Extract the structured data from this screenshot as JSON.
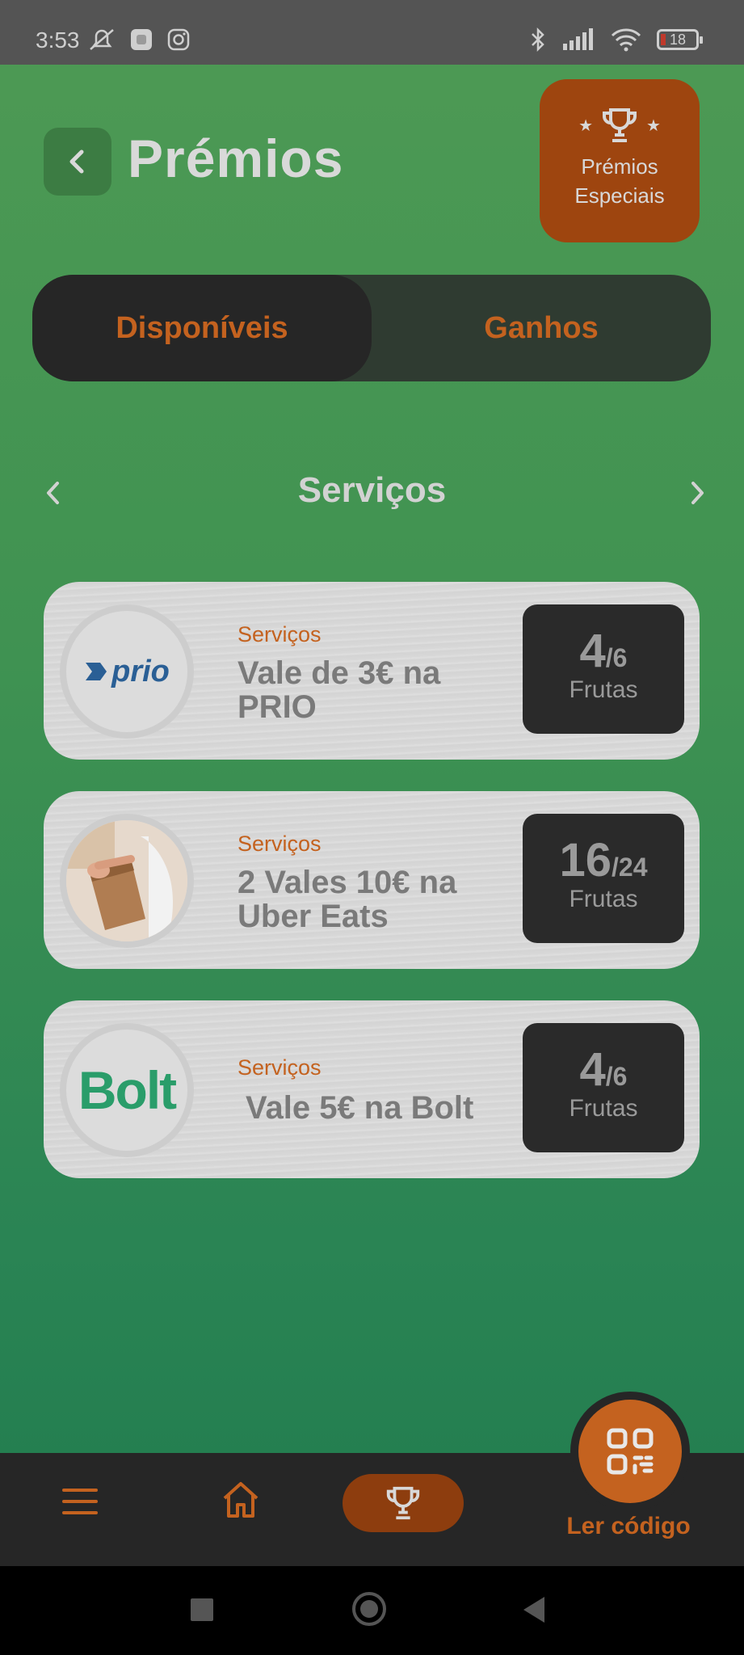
{
  "status_bar": {
    "time": "3:53",
    "left_icons": [
      "mute-notification-icon",
      "app-icon",
      "instagram-icon"
    ],
    "right_icons": [
      "bluetooth-icon",
      "signal-icon",
      "wifi-icon"
    ],
    "battery": "18",
    "battery_color": "#c0392b"
  },
  "header": {
    "title": "Prémios",
    "back_icon": "chevron-left-icon",
    "special_button": {
      "line1": "Prémios",
      "line2": "Especiais",
      "icon": "trophy-stars-icon"
    }
  },
  "tabs": [
    {
      "label": "Disponíveis",
      "active": true
    },
    {
      "label": "Ganhos",
      "active": false
    }
  ],
  "category": {
    "name": "Serviços"
  },
  "rewards": [
    {
      "category": "Serviços",
      "name": "Vale de 3€ na PRIO",
      "current": "4",
      "total": "/6",
      "unit": "Frutas",
      "logo": "prio",
      "logo_text": "prio"
    },
    {
      "category": "Serviços",
      "name": "2 Vales 10€ na Uber Eats",
      "current": "16",
      "total": "/24",
      "unit": "Frutas",
      "logo": "uber-eats-photo"
    },
    {
      "category": "Serviços",
      "name": "Vale 5€ na Bolt",
      "current": "4",
      "total": "/6",
      "unit": "Frutas",
      "logo": "bolt",
      "logo_text": "Bolt"
    }
  ],
  "bottom_nav": {
    "items": [
      "menu-icon",
      "home-icon",
      "trophy-icon"
    ],
    "qr_label": "Ler código"
  },
  "colors": {
    "accent": "#c4621f",
    "prio_blue": "#2a5f95",
    "bolt_green": "#2a9d6a"
  }
}
